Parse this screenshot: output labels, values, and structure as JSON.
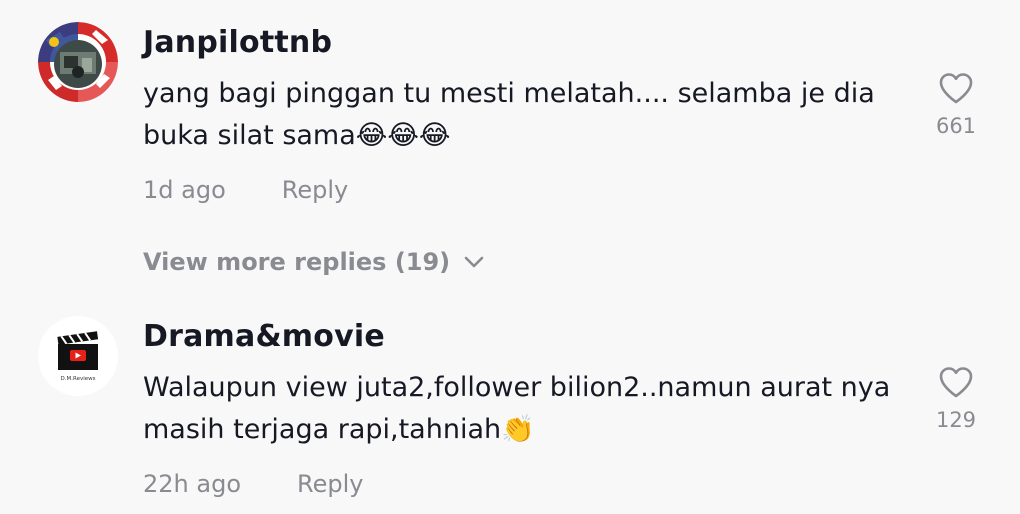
{
  "comments": [
    {
      "username": "Janpilottnb",
      "text": "yang bagi pinggan tu mesti melatah.... selamba je dia buka silat sama😂😂😂",
      "time": "1d ago",
      "reply_label": "Reply",
      "likes": "661",
      "avatar_icon": "flag-photo-avatar"
    },
    {
      "username": "Drama&movie",
      "text": "Walaupun view juta2,follower bilion2..namun aurat nya masih terjaga rapi,tahniah👏",
      "time": "22h ago",
      "reply_label": "Reply",
      "likes": "129",
      "avatar_icon": "clapperboard-logo-avatar",
      "avatar_caption": "D.M.Reviews"
    }
  ],
  "view_more": {
    "label": "View more replies (19)",
    "icon": "chevron-down-icon"
  },
  "colors": {
    "background": "#f8f8f8",
    "primary_text": "#161823",
    "secondary_text": "#8a8b91"
  }
}
